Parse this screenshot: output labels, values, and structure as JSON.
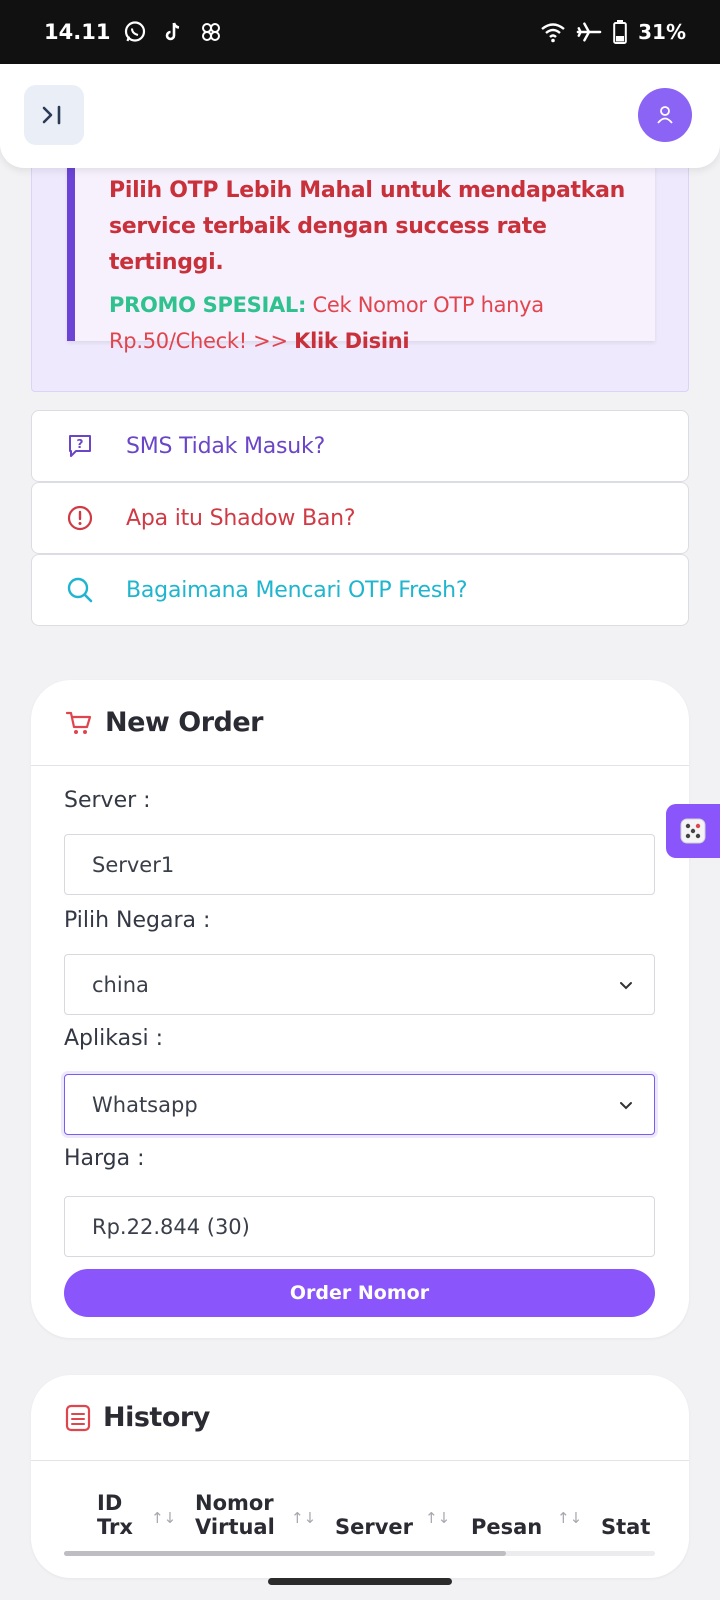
{
  "status_bar": {
    "time": "14.11",
    "battery": "31%",
    "left_icons": [
      "whatsapp-icon",
      "tiktok-icon",
      "pinwheel-icon"
    ],
    "right_icons": [
      "wifi-icon",
      "airplane-icon",
      "battery-icon"
    ]
  },
  "topbar": {
    "toggle_icon": "sidebar-toggle-icon",
    "avatar_icon": "user-icon"
  },
  "announcement": {
    "warning": "Pilih OTP Lebih Mahal untuk mendapatkan service terbaik dengan success rate tertinggi.",
    "promo_label": "PROMO SPESIAL:",
    "promo_text": " Cek Nomor OTP hanya Rp.50/Check! >> ",
    "promo_link": "Klik Disini"
  },
  "faq": [
    {
      "label": "SMS Tidak Masuk?",
      "icon": "question-icon",
      "color": "#6a45c8"
    },
    {
      "label": "Apa itu Shadow Ban?",
      "icon": "alert-circle-icon",
      "color": "#d03a45"
    },
    {
      "label": "Bagaimana Mencari OTP Fresh?",
      "icon": "search-icon",
      "color": "#1fb5cf"
    }
  ],
  "new_order": {
    "title": "New Order",
    "server_label": "Server :",
    "server_value": "Server1",
    "country_label": "Pilih Negara :",
    "country_value": "china",
    "app_label": "Aplikasi :",
    "app_value": "Whatsapp",
    "price_label": "Harga :",
    "price_value": "Rp.22.844 (30)",
    "order_button": "Order Nomor"
  },
  "history": {
    "title": "History",
    "columns": [
      {
        "line1": "ID",
        "line2": "Trx"
      },
      {
        "line1": "Nomor",
        "line2": "Virtual"
      },
      {
        "line1": "",
        "line2": "Server"
      },
      {
        "line1": "",
        "line2": "Pesan"
      },
      {
        "line1": "",
        "line2": "Stat"
      }
    ]
  },
  "colors": {
    "accent": "#8a55fa",
    "danger": "#c8303a",
    "success": "#2fc18e"
  }
}
